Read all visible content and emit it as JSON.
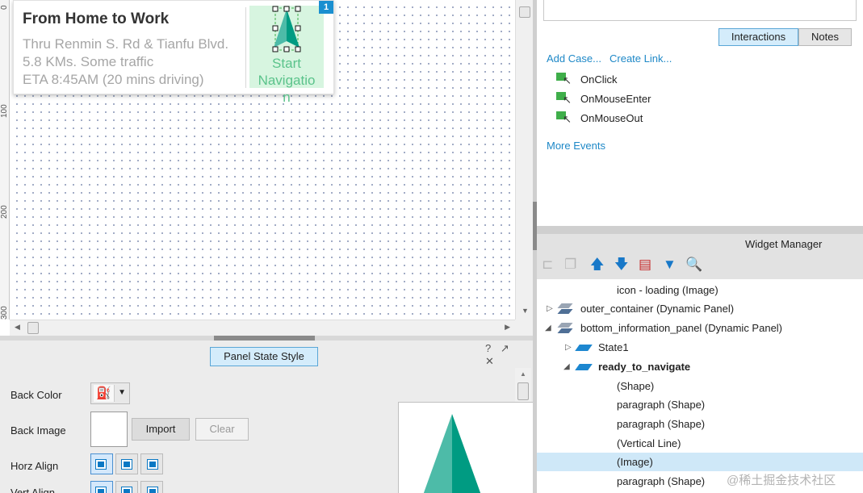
{
  "canvas": {
    "ruler_ticks": [
      "0",
      "100",
      "200",
      "300"
    ],
    "card": {
      "title": "From Home to Work",
      "line1": "Thru Renmin S. Rd & Tianfu Blvd.",
      "line2": "5.8 KMs.   Some traffic",
      "line3": "ETA 8:45AM (20 mins driving)",
      "nav_line1": "Start",
      "nav_line2": "Navigatio",
      "nav_line3": "n",
      "badge": "1",
      "nav_color": "#5bc38b"
    }
  },
  "style_panel": {
    "tab_label": "Panel State Style",
    "help": "?",
    "undock": "↗",
    "close": "✕",
    "back_color_label": "Back Color",
    "back_image_label": "Back Image",
    "import_label": "Import",
    "clear_label": "Clear",
    "horz_align_label": "Horz Align",
    "vert_align_label": "Vert Align"
  },
  "interactions": {
    "tab_interactions": "Interactions",
    "tab_notes": "Notes",
    "add_case": "Add Case...",
    "create_link": "Create Link...",
    "events": [
      "OnClick",
      "OnMouseEnter",
      "OnMouseOut"
    ],
    "more_events": "More Events"
  },
  "widget_manager": {
    "title": "Widget Manager",
    "tools": [
      "outline-icon",
      "duplicate-icon",
      "move-up-icon",
      "move-down-icon",
      "delete-state-icon",
      "filter-icon",
      "search-icon"
    ],
    "rows": [
      {
        "label": "icon - loading (Image)"
      },
      {
        "label": "outer_container (Dynamic Panel)"
      },
      {
        "label": "bottom_information_panel (Dynamic Panel)"
      },
      {
        "label": "State1"
      },
      {
        "label": "ready_to_navigate"
      },
      {
        "label": "(Shape)"
      },
      {
        "label": "paragraph (Shape)"
      },
      {
        "label": "paragraph (Shape)"
      },
      {
        "label": "(Vertical Line)"
      },
      {
        "label": "(Image)"
      },
      {
        "label": "paragraph (Shape)"
      }
    ]
  },
  "watermark": "@稀土掘金技术社区",
  "colors": {
    "accent": "#1e88c7",
    "selected_bg": "#cfe8f8",
    "tab_active": "#d4ecfb",
    "teal_dark": "#009b82",
    "teal_light": "#4dbba8"
  }
}
